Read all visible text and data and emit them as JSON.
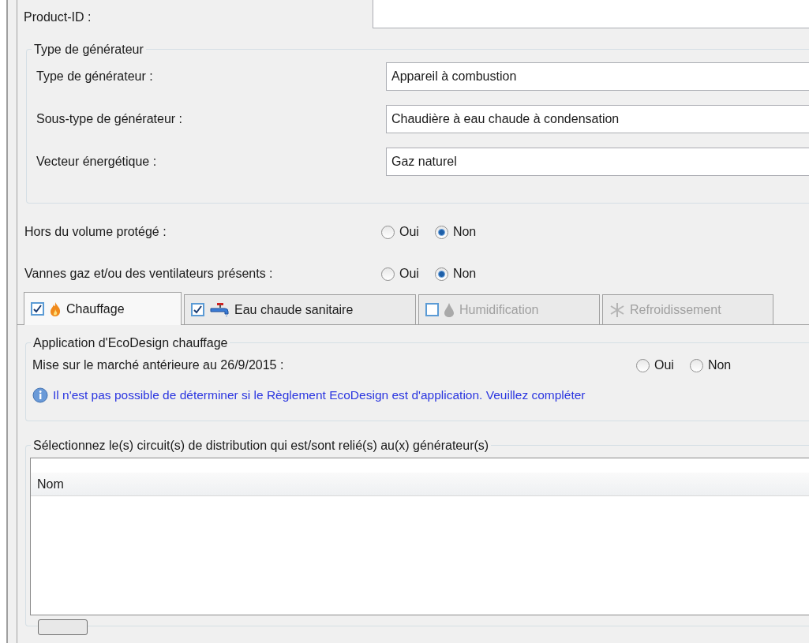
{
  "product_id": {
    "label": "Product-ID :"
  },
  "generator_group": {
    "title": "Type de générateur",
    "fields": [
      {
        "label": "Type de générateur :",
        "value": "Appareil à combustion"
      },
      {
        "label": "Sous-type de générateur :",
        "value": "Chaudière à eau chaude à condensation"
      },
      {
        "label": "Vecteur énergétique :",
        "value": "Gaz naturel"
      }
    ]
  },
  "radio_rows": [
    {
      "label": "Hors du volume protégé :",
      "options": [
        {
          "label": "Oui",
          "selected": false
        },
        {
          "label": "Non",
          "selected": true
        }
      ]
    },
    {
      "label": "Vannes gaz et/ou des ventilateurs présents :",
      "options": [
        {
          "label": "Oui",
          "selected": false
        },
        {
          "label": "Non",
          "selected": true
        }
      ]
    }
  ],
  "tabs": [
    {
      "label": "Chauffage",
      "kind": "checkbox",
      "checked": true,
      "disabled": false,
      "selected": true
    },
    {
      "label": "Eau chaude sanitaire",
      "kind": "checkbox",
      "checked": true,
      "disabled": false,
      "selected": false
    },
    {
      "label": "Humidification",
      "kind": "checkbox",
      "checked": false,
      "disabled": true,
      "selected": false
    },
    {
      "label": "Refroidissement",
      "kind": "plain",
      "disabled": true,
      "selected": false
    }
  ],
  "ecodesign": {
    "title": "Application d'EcoDesign chauffage",
    "question": {
      "label": "Mise sur le marché antérieure au 26/9/2015 :",
      "options": [
        {
          "label": "Oui",
          "selected": false
        },
        {
          "label": "Non",
          "selected": false
        }
      ]
    },
    "info": "Il n'est pas possible de déterminer si le Règlement EcoDesign est d'application. Veuillez compléter"
  },
  "circuits": {
    "title": "Sélectionnez le(s) circuit(s) de distribution qui est/sont relié(s) au(x) générateur(s)",
    "table": {
      "columns": [
        "Nom"
      ]
    }
  }
}
